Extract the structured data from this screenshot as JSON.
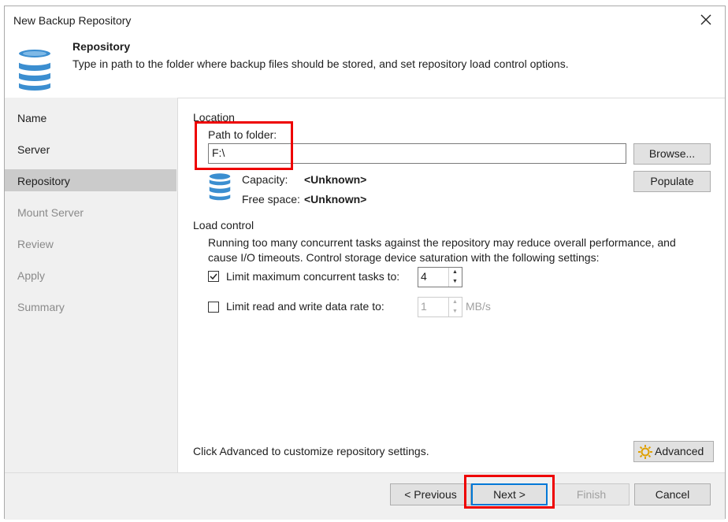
{
  "window": {
    "title": "New Backup Repository"
  },
  "header": {
    "title": "Repository",
    "description": "Type in path to the folder where backup files should be stored, and set repository load control options."
  },
  "nav": {
    "items": [
      {
        "label": "Name",
        "state": "done"
      },
      {
        "label": "Server",
        "state": "done"
      },
      {
        "label": "Repository",
        "state": "selected"
      },
      {
        "label": "Mount Server",
        "state": "pending"
      },
      {
        "label": "Review",
        "state": "pending"
      },
      {
        "label": "Apply",
        "state": "pending"
      },
      {
        "label": "Summary",
        "state": "pending"
      }
    ]
  },
  "location": {
    "group_label": "Location",
    "path_label": "Path to folder:",
    "path_value": "F:\\",
    "browse_label": "Browse...",
    "populate_label": "Populate",
    "capacity_label": "Capacity:",
    "capacity_value": "<Unknown>",
    "free_label": "Free space:",
    "free_value": "<Unknown>"
  },
  "load_control": {
    "group_label": "Load control",
    "description_line1": "Running too many concurrent tasks against the repository may reduce overall performance, and",
    "description_line2": "cause I/O timeouts. Control storage device saturation with the following settings:",
    "limit_tasks_label": "Limit maximum concurrent tasks to:",
    "limit_tasks_checked": true,
    "limit_tasks_value": "4",
    "limit_rate_label": "Limit read and write data rate to:",
    "limit_rate_checked": false,
    "limit_rate_value": "1",
    "rate_unit": "MB/s"
  },
  "advanced": {
    "hint": "Click Advanced to customize repository settings.",
    "button_label": "Advanced"
  },
  "footer": {
    "previous_label": "< Previous",
    "next_label": "Next >",
    "finish_label": "Finish",
    "cancel_label": "Cancel"
  },
  "colors": {
    "highlight": "#ee0000",
    "selected_nav": "#cbcbcb",
    "db_icon": "#3b8ed0"
  }
}
